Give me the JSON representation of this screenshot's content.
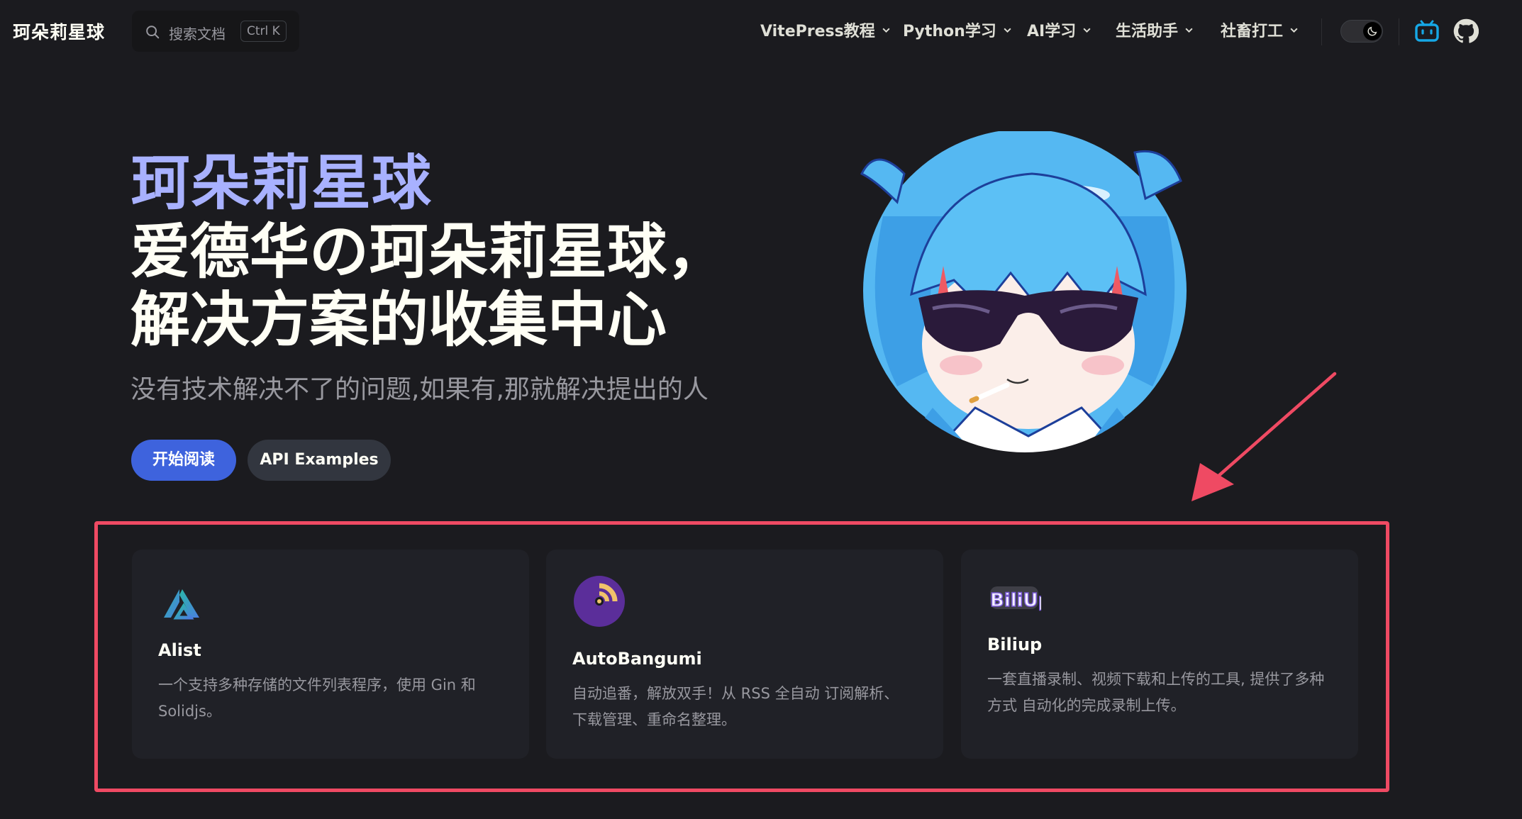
{
  "nav": {
    "site_title": "珂朵莉星球",
    "search": {
      "placeholder": "搜索文档",
      "shortcut": "Ctrl K"
    },
    "menu": [
      {
        "label": "VitePress教程"
      },
      {
        "label": "Python学习"
      },
      {
        "label": "AI学习"
      },
      {
        "label": "生活助手"
      },
      {
        "label": "社畜打工"
      }
    ],
    "icons": [
      "search-icon",
      "chevron-down-icon",
      "moon-icon",
      "bilibili-icon",
      "github-icon"
    ]
  },
  "hero": {
    "name": "珂朵莉星球",
    "text_line1": "爱德华の珂朵莉星球，",
    "text_line2": "解决方案的收集中心",
    "tagline": "没有技术解决不了的问题,如果有,那就解决提出的人",
    "actions": [
      {
        "label": "开始阅读",
        "theme": "brand"
      },
      {
        "label": "API Examples",
        "theme": "alt"
      }
    ]
  },
  "features": [
    {
      "title": "Alist",
      "desc": "一个支持多种存储的文件列表程序，使用 Gin 和 Solidjs。",
      "icon": "alist-logo-icon"
    },
    {
      "title": "AutoBangumi",
      "desc": "自动追番，解放双手！从 RSS 全自动 订阅解析、下载管理、重命名整理。",
      "icon": "autobangumi-logo-icon"
    },
    {
      "title": "Biliup",
      "desc": "一套直播录制、视频下载和上传的工具, 提供了多种方式 自动化的完成录制上传。",
      "icon": "biliup-logo-icon"
    }
  ],
  "colors": {
    "background": "#1b1b1f",
    "brand": "#3e63dd",
    "name_accent": "#a8b1ff",
    "highlight_border": "#ef4a63",
    "card_bg": "#202127"
  }
}
